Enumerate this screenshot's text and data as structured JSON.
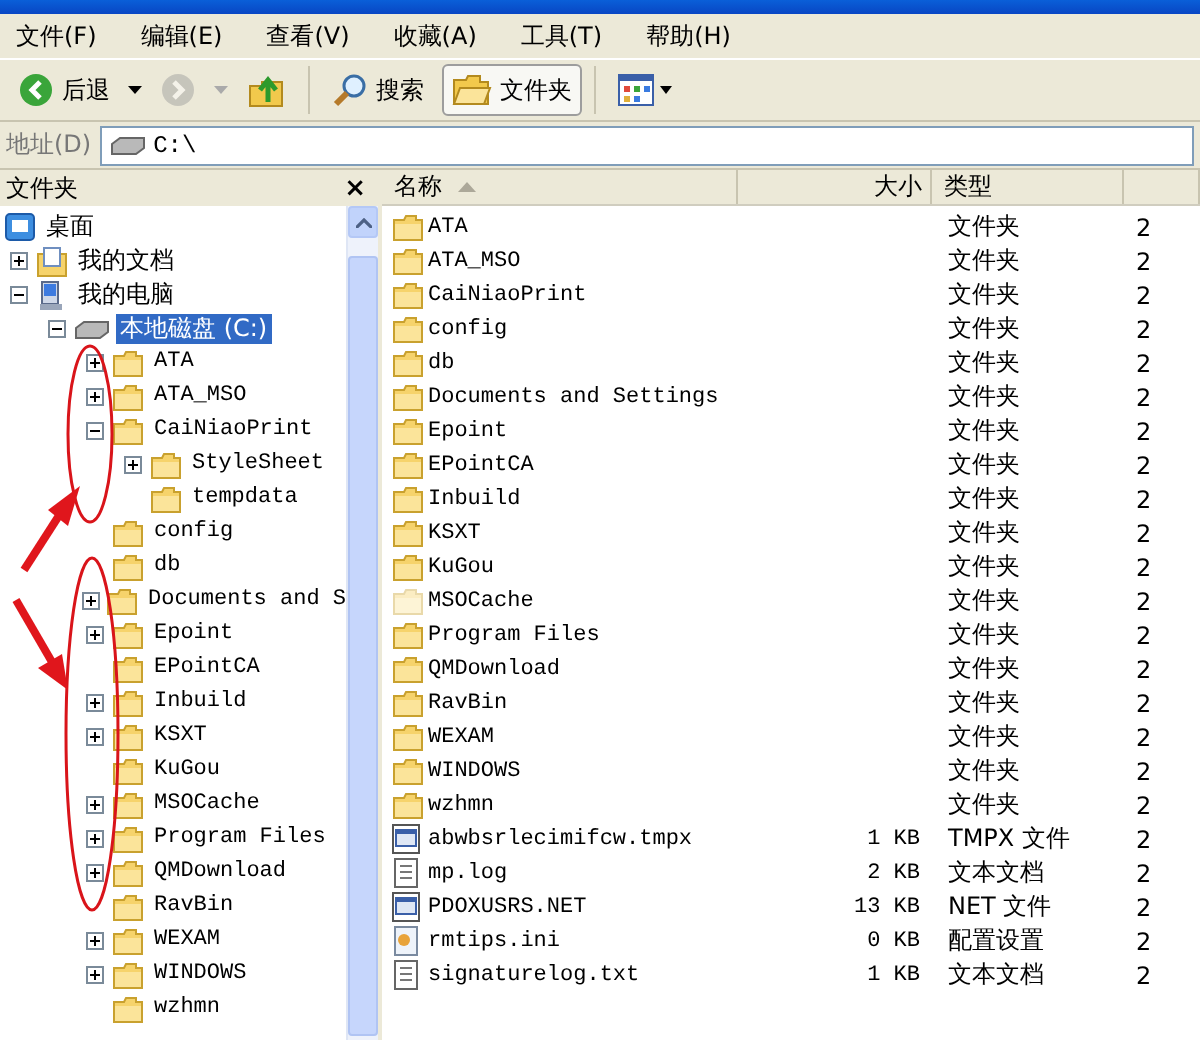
{
  "menu": [
    "文件(F)",
    "编辑(E)",
    "查看(V)",
    "收藏(A)",
    "工具(T)",
    "帮助(H)"
  ],
  "toolbar": {
    "back": {
      "label": "后退",
      "disabled": false
    },
    "forward": {
      "disabled": true
    },
    "search": {
      "label": "搜索"
    },
    "folders": {
      "label": "文件夹",
      "selected": true
    }
  },
  "address": {
    "label": "地址(D)",
    "value": "C:\\"
  },
  "folder_pane": {
    "title": "文件夹",
    "close": "×",
    "tree": [
      {
        "label": "桌面",
        "kind": "desktop",
        "selected": false,
        "children": [
          {
            "label": "我的文档",
            "kind": "documents",
            "expanded": false,
            "selected": false
          },
          {
            "label": "我的电脑",
            "kind": "computer",
            "expanded": true,
            "selected": false,
            "children": [
              {
                "label": "本地磁盘 (C:)",
                "kind": "drive",
                "expanded": true,
                "selected": true,
                "children": [
                  {
                    "label": "ATA",
                    "kind": "folder",
                    "expanded": false,
                    "selected": false
                  },
                  {
                    "label": "ATA_MSO",
                    "kind": "folder",
                    "expanded": false,
                    "selected": false
                  },
                  {
                    "label": "CaiNiaoPrint",
                    "kind": "folder",
                    "expanded": true,
                    "selected": false,
                    "children": [
                      {
                        "label": "StyleSheet",
                        "kind": "folder",
                        "expanded": false,
                        "selected": false
                      },
                      {
                        "label": "tempdata",
                        "kind": "folder",
                        "selected": false
                      }
                    ]
                  },
                  {
                    "label": "config",
                    "kind": "folder",
                    "selected": false
                  },
                  {
                    "label": "db",
                    "kind": "folder",
                    "selected": false
                  },
                  {
                    "label": "Documents and S",
                    "kind": "folder",
                    "expanded": false,
                    "selected": false
                  },
                  {
                    "label": "Epoint",
                    "kind": "folder",
                    "expanded": false,
                    "selected": false
                  },
                  {
                    "label": "EPointCA",
                    "kind": "folder",
                    "selected": false
                  },
                  {
                    "label": "Inbuild",
                    "kind": "folder",
                    "expanded": false,
                    "selected": false
                  },
                  {
                    "label": "KSXT",
                    "kind": "folder",
                    "expanded": false,
                    "selected": false
                  },
                  {
                    "label": "KuGou",
                    "kind": "folder",
                    "selected": false
                  },
                  {
                    "label": "MSOCache",
                    "kind": "folder",
                    "expanded": false,
                    "selected": false
                  },
                  {
                    "label": "Program Files",
                    "kind": "folder",
                    "expanded": false,
                    "selected": false
                  },
                  {
                    "label": "QMDownload",
                    "kind": "folder",
                    "expanded": false,
                    "selected": false
                  },
                  {
                    "label": "RavBin",
                    "kind": "folder",
                    "selected": false
                  },
                  {
                    "label": "WEXAM",
                    "kind": "folder",
                    "expanded": false,
                    "selected": false
                  },
                  {
                    "label": "WINDOWS",
                    "kind": "folder",
                    "expanded": false,
                    "selected": false
                  },
                  {
                    "label": "wzhmn",
                    "kind": "folder",
                    "selected": false
                  }
                ]
              }
            ]
          }
        ]
      }
    ]
  },
  "file_list": {
    "columns": [
      {
        "label": "名称",
        "sorted": true
      },
      {
        "label": "大小",
        "sorted": false
      },
      {
        "label": "类型",
        "sorted": false
      }
    ],
    "rows": [
      {
        "kind": "folder",
        "name": "ATA",
        "type": "文件夹",
        "column_4": "2"
      },
      {
        "kind": "folder",
        "name": "ATA_MSO",
        "type": "文件夹",
        "column_4": "2"
      },
      {
        "kind": "folder",
        "name": "CaiNiaoPrint",
        "type": "文件夹",
        "column_4": "2"
      },
      {
        "kind": "folder",
        "name": "config",
        "type": "文件夹",
        "column_4": "2"
      },
      {
        "kind": "folder",
        "name": "db",
        "type": "文件夹",
        "column_4": "2"
      },
      {
        "kind": "folder",
        "name": "Documents and Settings",
        "type": "文件夹",
        "column_4": "2"
      },
      {
        "kind": "folder",
        "name": "Epoint",
        "type": "文件夹",
        "column_4": "2"
      },
      {
        "kind": "folder",
        "name": "EPointCA",
        "type": "文件夹",
        "column_4": "2"
      },
      {
        "kind": "folder",
        "name": "Inbuild",
        "type": "文件夹",
        "column_4": "2"
      },
      {
        "kind": "folder",
        "name": "KSXT",
        "type": "文件夹",
        "column_4": "2"
      },
      {
        "kind": "folder",
        "name": "KuGou",
        "type": "文件夹",
        "column_4": "2"
      },
      {
        "kind": "hidden-folder",
        "name": "MSOCache",
        "type": "文件夹",
        "column_4": "2"
      },
      {
        "kind": "folder",
        "name": "Program Files",
        "type": "文件夹",
        "column_4": "2"
      },
      {
        "kind": "folder",
        "name": "QMDownload",
        "type": "文件夹",
        "column_4": "2"
      },
      {
        "kind": "folder",
        "name": "RavBin",
        "type": "文件夹",
        "column_4": "2"
      },
      {
        "kind": "folder",
        "name": "WEXAM",
        "type": "文件夹",
        "column_4": "2"
      },
      {
        "kind": "folder",
        "name": "WINDOWS",
        "type": "文件夹",
        "column_4": "2"
      },
      {
        "kind": "folder",
        "name": "wzhmn",
        "type": "文件夹",
        "column_4": "2"
      },
      {
        "kind": "app-file",
        "name": "abwbsrlecimifcw.tmpx",
        "size": "1 KB",
        "type": "TMPX 文件",
        "column_4": "2"
      },
      {
        "kind": "text-file",
        "name": "mp.log",
        "size": "2 KB",
        "type": "文本文档",
        "column_4": "2"
      },
      {
        "kind": "app-file",
        "name": "PDOXUSRS.NET",
        "size": "13 KB",
        "type": "NET 文件",
        "column_4": "2"
      },
      {
        "kind": "settings-file",
        "name": "rmtips.ini",
        "size": "0 KB",
        "type": "配置设置",
        "column_4": "2"
      },
      {
        "kind": "text-file",
        "name": "signaturelog.txt",
        "size": "1 KB",
        "type": "文本文档",
        "column_4": "2"
      }
    ]
  }
}
